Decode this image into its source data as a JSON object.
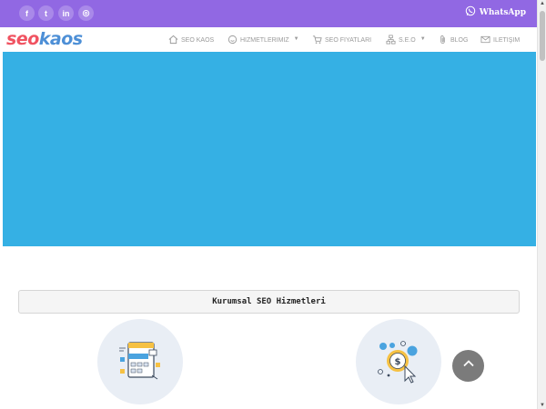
{
  "topbar": {
    "social": [
      {
        "icon": "facebook-icon",
        "glyph": "f"
      },
      {
        "icon": "twitter-icon",
        "glyph": "t"
      },
      {
        "icon": "linkedin-icon",
        "glyph": "in"
      },
      {
        "icon": "instagram-icon",
        "glyph": "◎"
      }
    ],
    "whatsapp_label": "WhatsApp"
  },
  "logo": {
    "part1": "seo",
    "part2": "kaos"
  },
  "nav": {
    "home": "SEO KAOS",
    "services": "HIZMETLERIMIZ",
    "prices": "SEO FIYATLARI",
    "seo": "S.E.O",
    "blog": "BLOG",
    "contact": "ILETIŞIM"
  },
  "section": {
    "title": "Kurumsal SEO Hizmetleri"
  },
  "colors": {
    "topbar": "#9168e3",
    "hero": "#35b0e4",
    "logo_seo": "#f05361",
    "logo_kaos": "#4d8fd6",
    "scroll_top_button": "#7b7b7b"
  }
}
